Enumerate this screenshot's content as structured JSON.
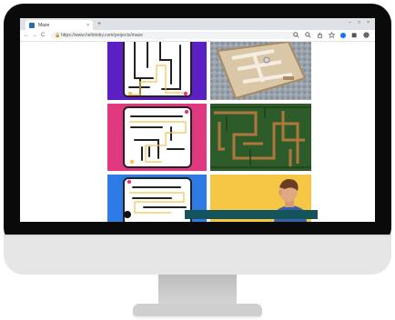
{
  "browser": {
    "tab_title": "Maze",
    "tab_close": "×",
    "new_tab": "+",
    "url": "https://www.hellotoby.com/projects/maze",
    "nav_back": "←",
    "nav_forward": "→",
    "nav_reload": "C",
    "lock": "🔒",
    "window_minimize": "–",
    "window_maximize": "□",
    "window_close": "×"
  },
  "gallery": {
    "tiles": [
      {
        "name": "purple-maze-drawing",
        "bg": "#5b1fc4"
      },
      {
        "name": "wooden-maze-photo",
        "bg": "#9aa3ad"
      },
      {
        "name": "pink-maze-drawing",
        "bg": "#e0397f"
      },
      {
        "name": "hedge-maze-photo",
        "bg": "#2e5b2a"
      },
      {
        "name": "blue-maze-drawing",
        "bg": "#2e7be6"
      },
      {
        "name": "person-illustration",
        "bg": "#f6c744"
      }
    ]
  },
  "colors": {
    "banner": "#14555c",
    "accent_blue": "#1a73e8"
  }
}
